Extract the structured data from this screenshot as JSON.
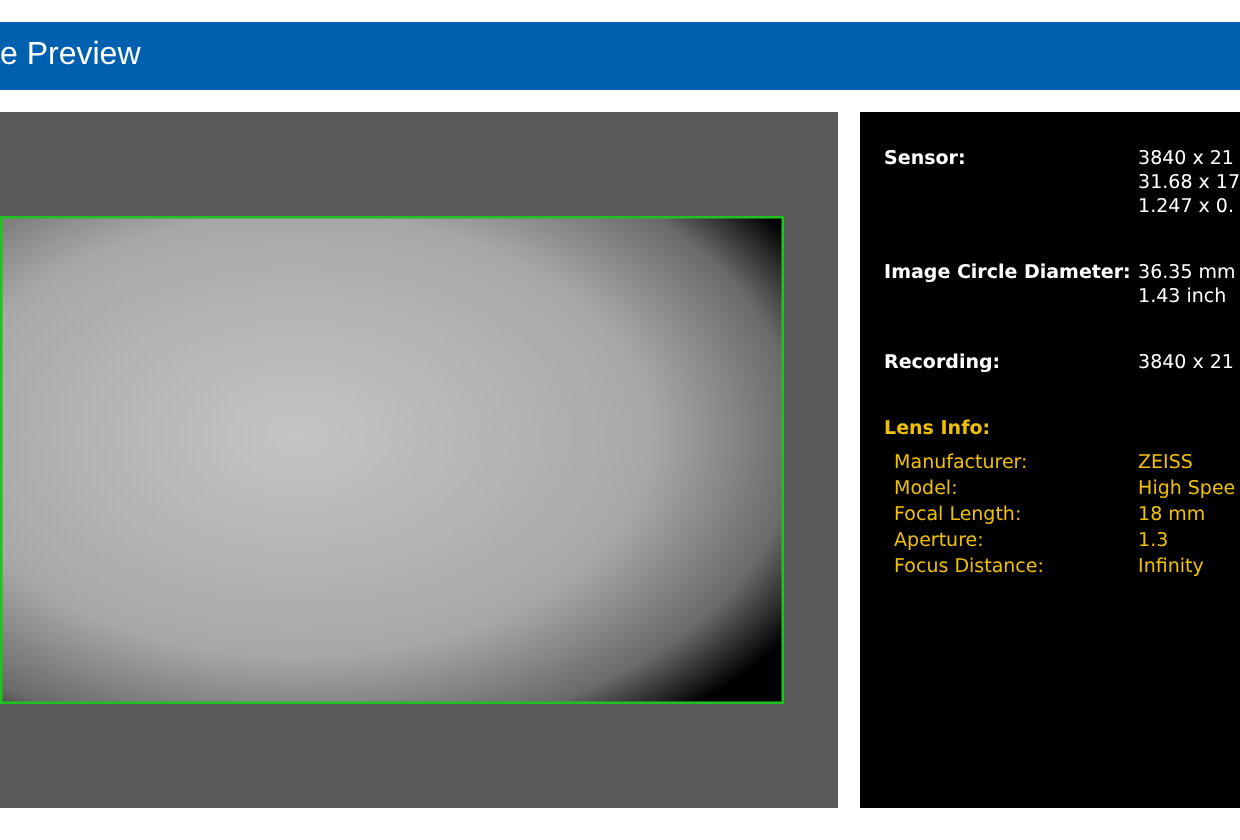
{
  "header": {
    "title": "e Preview"
  },
  "specs": [
    {
      "label": "Sensor:",
      "values": [
        "3840 x 21",
        "31.68 x 17",
        "1.247 x 0."
      ]
    },
    {
      "label": "Image Circle Diameter:",
      "values": [
        "36.35 mm",
        "1.43 inch"
      ]
    },
    {
      "label": "Recording:",
      "values": [
        "3840 x 21"
      ]
    }
  ],
  "lens_info": {
    "title": "Lens Info:",
    "rows": [
      {
        "label": "Manufacturer:",
        "value": "ZEISS"
      },
      {
        "label": "Model:",
        "value": "High Spee"
      },
      {
        "label": "Focal Length:",
        "value": "18 mm"
      },
      {
        "label": "Aperture:",
        "value": "1.3"
      },
      {
        "label": "Focus Distance:",
        "value": "Infinity"
      }
    ]
  }
}
